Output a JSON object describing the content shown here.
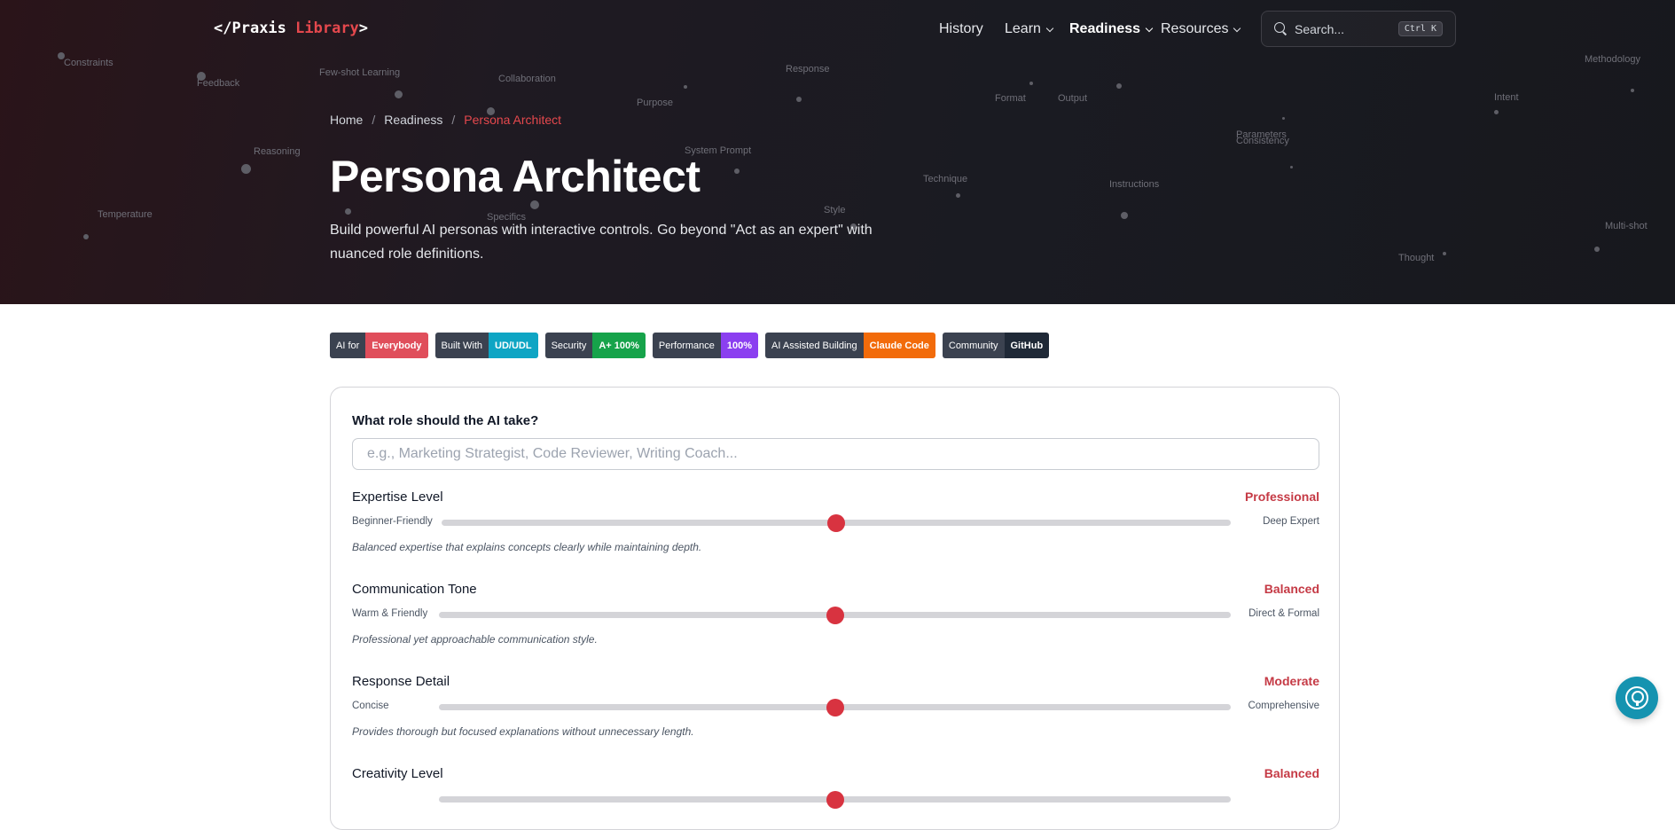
{
  "header": {
    "logo_prefix": "</",
    "logo_main": "Praxis ",
    "logo_accent": "Library",
    "logo_suffix": ">",
    "nav": [
      {
        "label": "History",
        "dropdown": false,
        "active": false
      },
      {
        "label": "Learn",
        "dropdown": true,
        "active": false
      },
      {
        "label": "Readiness",
        "dropdown": true,
        "active": true
      },
      {
        "label": "Resources",
        "dropdown": true,
        "active": false
      }
    ],
    "search_placeholder": "Search...",
    "search_shortcut": "Ctrl K"
  },
  "background_words": [
    "Constraints",
    "Feedback",
    "Few-shot Learning",
    "Collaboration",
    "Purpose",
    "Response",
    "Format",
    "Output",
    "Methodology",
    "Intent",
    "Parameters",
    "Consistency",
    "Reasoning",
    "System Prompt",
    "Technique",
    "Instructions",
    "Temperature",
    "Specifics",
    "Style",
    "Multi-shot",
    "Thought"
  ],
  "breadcrumb": {
    "home": "Home",
    "section": "Readiness",
    "current": "Persona Architect",
    "separator": "/"
  },
  "hero": {
    "title": "Persona Architect",
    "subtitle": "Build powerful AI personas with interactive controls. Go beyond \"Act as an expert\" with nuanced role definitions."
  },
  "badges": [
    {
      "label": "AI for",
      "value": "Everybody",
      "color": "#e04e5b"
    },
    {
      "label": "Built With",
      "value": "UD/UDL",
      "color": "#0ea5c4"
    },
    {
      "label": "Security",
      "value": "A+ 100%",
      "color": "#16a34a"
    },
    {
      "label": "Performance",
      "value": "100%",
      "color": "#8b3ff0"
    },
    {
      "label": "AI Assisted Building",
      "value": "Claude Code",
      "color": "#f26b0a"
    },
    {
      "label": "Community",
      "value": "GitHub",
      "color": "#1f2937"
    }
  ],
  "form": {
    "role_label": "What role should the AI take?",
    "role_placeholder": "e.g., Marketing Strategist, Code Reviewer, Writing Coach...",
    "role_value": ""
  },
  "sliders": [
    {
      "title": "Expertise Level",
      "value_label": "Professional",
      "min_label": "Beginner-Friendly",
      "max_label": "Deep Expert",
      "position": 0.5,
      "description": "Balanced expertise that explains concepts clearly while maintaining depth."
    },
    {
      "title": "Communication Tone",
      "value_label": "Balanced",
      "min_label": "Warm & Friendly",
      "max_label": "Direct & Formal",
      "position": 0.5,
      "description": "Professional yet approachable communication style."
    },
    {
      "title": "Response Detail",
      "value_label": "Moderate",
      "min_label": "Concise",
      "max_label": "Comprehensive",
      "position": 0.5,
      "description": "Provides thorough but focused explanations without unnecessary length."
    },
    {
      "title": "Creativity Level",
      "value_label": "Balanced",
      "min_label": "",
      "max_label": "",
      "position": 0.5,
      "description": ""
    }
  ],
  "colors": {
    "accent": "#e5484d",
    "slider_thumb": "#d83340",
    "help_button": "#1593b0"
  },
  "help_button_icon": "accessibility-icon"
}
